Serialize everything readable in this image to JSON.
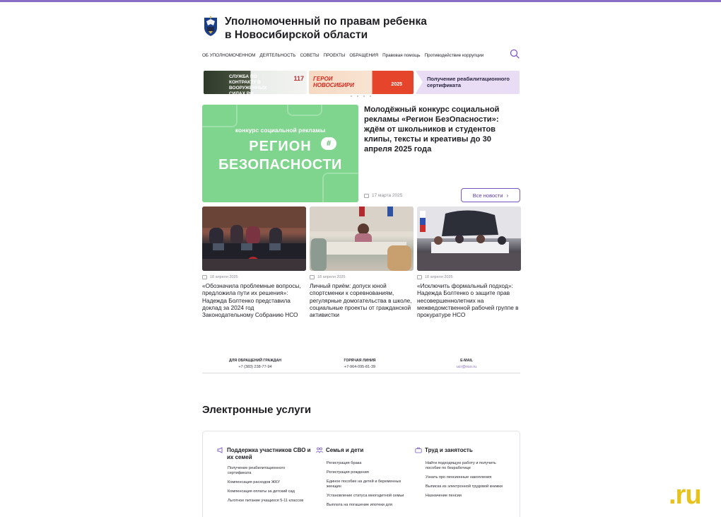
{
  "header": {
    "title_line1": "Уполномоченный по правам ребенка",
    "title_line2": "в Новосибирской области"
  },
  "nav": {
    "items": [
      "ОБ УПОЛНОМОЧЕННОМ",
      "ДЕЯТЕЛЬНОСТЬ",
      "СОВЕТЫ",
      "ПРОЕКТЫ",
      "ОБРАЩЕНИЯ",
      "Правовая помощь",
      "Противодействие коррупции"
    ]
  },
  "banners": {
    "b1_text": "СЛУЖБА ПО КОНТРАКТУ В ВООРУЖЕННЫХ СИЛАХ РФ",
    "b1_number": "117",
    "b2_text": "ГЕРОИ НОВОСИБИРИ",
    "b2_year": "2025",
    "b3_text": "Получение реабилитационного сертификата"
  },
  "featured": {
    "image_sub": "конкурс социальной рекламы",
    "image_big1": "РЕГИОН",
    "image_big2": "БЕЗОПАСНОСТИ",
    "image_hash": "#",
    "title": "Молодёжный конкурс социальной рекламы «Регион БезОпасности»: ждём от школьников и студентов клипы, тексты и креативы до 30 апреля 2025 года",
    "date": "17 марта 2025",
    "all_news_label": "Все новости"
  },
  "cards": [
    {
      "date": "18 апреля 2025",
      "title": "«Обозначила проблемные вопросы, предложила пути их решения»: Надежда Болтенко представила доклад за 2024 год Законодательному Собранию НСО"
    },
    {
      "date": "18 апреля 2025",
      "title": "Личный приём: допуск юной спортсменки к соревнованиям, регулярные домогательства в школе, социальные проекты от гражданской активистки"
    },
    {
      "date": "18 апреля 2025",
      "title": "«Исключить формальный подход»: Надежда Болтенко о защите прав несовершеннолетних на межведомственной рабочей группе в прокуратуре НСО"
    }
  ],
  "contacts": [
    {
      "label": "ДЛЯ ОБРАЩЕНИЙ ГРАЖДАН",
      "value": "+7 (383) 238-77-94"
    },
    {
      "label": "ГОРЯЧАЯ ЛИНИЯ",
      "value": "+7-964-095-81-39"
    },
    {
      "label": "E-MAIL",
      "value": "ucr@nso.ru"
    }
  ],
  "services": {
    "title": "Электронные услуги",
    "columns": [
      {
        "head": "Поддержка участников СВО и их семей",
        "items": [
          "Получение реабилитационного сертификата",
          "Компенсация расходов ЖКУ",
          "Компенсация оплаты за детский сад",
          "Льготное питание учащихся 5-11 классов"
        ]
      },
      {
        "head": "Семья и дети",
        "items": [
          "Регистрация брака",
          "Регистрация рождения",
          "Единое пособие на детей и беременных женщин",
          "Установление статуса многодетной семьи",
          "Выплата на погашение ипотеки для"
        ]
      },
      {
        "head": "Труд и занятость",
        "items": [
          "Найти подходящую работу и получить пособие по безработице",
          "Узнать про пенсионные накопления",
          "Выписка из электронной трудовой книжки",
          "Назначение пенсии"
        ]
      }
    ]
  },
  "watermark": ".ru",
  "colors": {
    "accent": "#8b6fc4",
    "button_border": "#7a57c0",
    "featured_bg": "#7fd48e",
    "watermark": "#e7c21c"
  }
}
